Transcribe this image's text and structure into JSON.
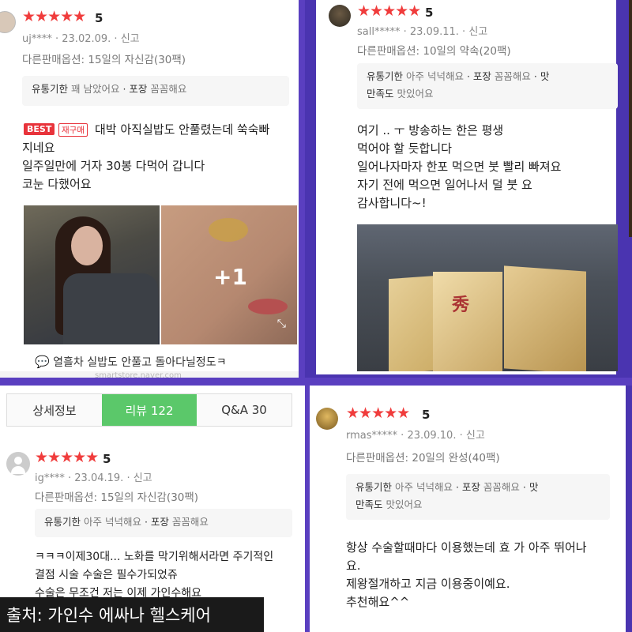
{
  "review1": {
    "rating": "5",
    "stars": "★★★★★",
    "user": "uj****",
    "date": "23.02.09.",
    "report": "신고",
    "option": "다른판매옵션: 15일의 자신감(30팩)",
    "expiry_label": "유통기한",
    "expiry_value": "꽤 남았어요",
    "pack_label": "포장",
    "pack_value": "꼼꼼해요",
    "badge_best": "BEST",
    "badge_repurchase": "재구매",
    "text": "대박 아직실밥도 안풀렸는데 쑥숙빠\n지네요\n일주일만에 거자 30봉 다먹어 갑니다\n코눈 다했어요",
    "photo_more": "+1",
    "comment": "열흘차 실밥도 안풀고 돌아다닐정도ㅋ",
    "watermark": "smartstore.naver.com"
  },
  "review2": {
    "rating": "5",
    "stars": "★★★★★",
    "user": "sall*****",
    "date": "23.09.11.",
    "report": "신고",
    "option": "다른판매옵션: 10일의 약속(20팩)",
    "expiry_label": "유통기한",
    "expiry_value": "아주 넉넉해요",
    "pack_label": "포장",
    "pack_value": "꼼꼼해요",
    "taste_label": "맛",
    "taste_label2": "만족도",
    "taste_value": "맛있어요",
    "text": "여기 .. ㅜ 방송하는 한은 평생\n먹어야 할 듯합니다\n일어나자마자 한포 먹으면 붓   빨리 빠져요\n자기 전에 먹으면 일어나서 덜 붓   요\n감사합니다~!"
  },
  "review3": {
    "tabs": [
      {
        "label": "상세정보"
      },
      {
        "label": "리뷰 122"
      },
      {
        "label": "Q&A 30"
      }
    ],
    "rating": "5",
    "stars": "★★★★★",
    "user": "ig****",
    "date": "23.04.19.",
    "report": "신고",
    "option": "다른판매옵션: 15일의 자신감(30팩)",
    "expiry_label": "유통기한",
    "expiry_value": "아주 넉넉해요",
    "pack_label": "포장",
    "pack_value": "꼼꼼해요",
    "text": "ㅋㅋㅋ이제30대... 노화를 막기위해서라면 주기적인\n결점 시술 수술은 필수가되었쥬\n수술은 무조건 저는 이제 가인수해요"
  },
  "review4": {
    "rating": "5",
    "stars": "★★★★★",
    "user": "rmas*****",
    "date": "23.09.10.",
    "report": "신고",
    "option": "다른판매옵션: 20일의 완성(40팩)",
    "expiry_label": "유통기한",
    "expiry_value": "아주 넉넉해요",
    "pack_label": "포장",
    "pack_value": "꼼꼼해요",
    "taste_label": "맛",
    "taste_label2": "만족도",
    "taste_value": "맛있어요",
    "text": "항상 수술할때마다 이용했는데 효   가 아주 뛰어나\n요.\n제왕절개하고 지금 이용중이예요.\n추천해요^^"
  },
  "caption": "출처: 가인수 에싸나 헬스케어",
  "colors": {
    "star": "#f03c3c",
    "tab_active": "#5bc86a",
    "frame": "#4a34b0",
    "best": "#e8333b"
  }
}
